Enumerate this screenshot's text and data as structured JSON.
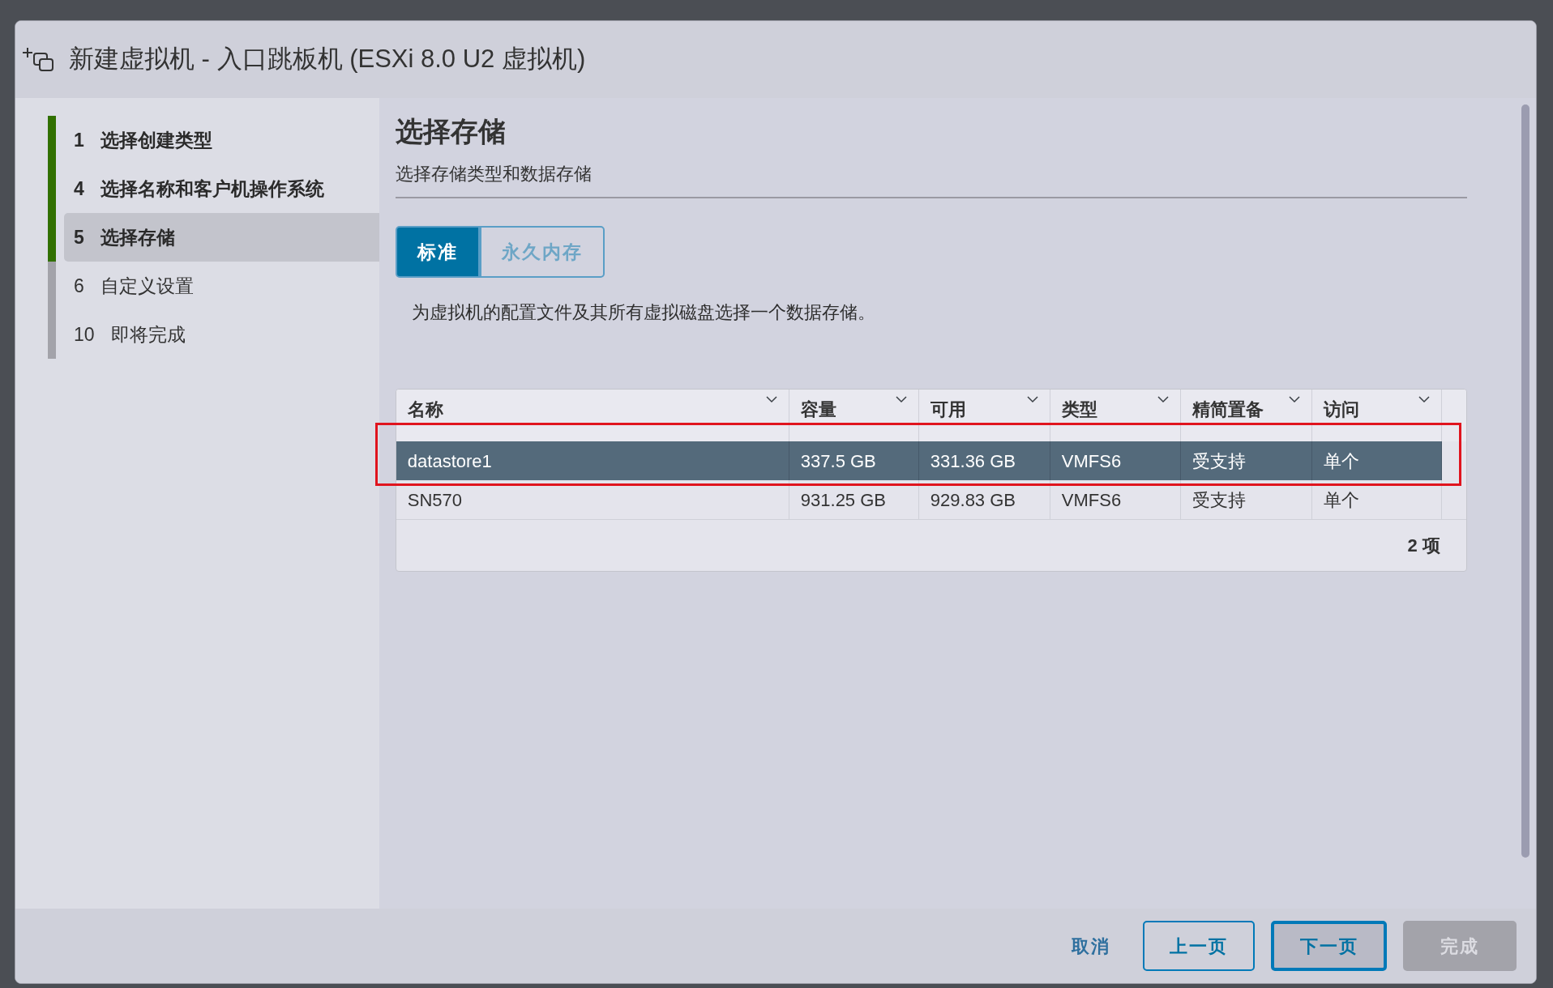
{
  "window": {
    "title": "新建虚拟机 - 入口跳板机 (ESXi 8.0 U2 虚拟机)"
  },
  "steps": [
    {
      "number": "1",
      "label": "选择创建类型",
      "reached": true,
      "selected": false
    },
    {
      "number": "4",
      "label": "选择名称和客户机操作系统",
      "reached": true,
      "selected": false
    },
    {
      "number": "5",
      "label": "选择存储",
      "reached": true,
      "selected": true
    },
    {
      "number": "6",
      "label": "自定义设置",
      "reached": false,
      "selected": false
    },
    {
      "number": "10",
      "label": "即将完成",
      "reached": false,
      "selected": false
    }
  ],
  "page": {
    "title": "选择存储",
    "subtitle": "选择存储类型和数据存储"
  },
  "tabs": [
    {
      "label": "标准",
      "selected": true
    },
    {
      "label": "永久内存",
      "selected": false
    }
  ],
  "description": "为虚拟机的配置文件及其所有虚拟磁盘选择一个数据存储。",
  "table": {
    "columns": [
      "名称",
      "容量",
      "可用",
      "类型",
      "精简置备",
      "访问"
    ],
    "rows": [
      {
        "cells": [
          "datastore1",
          "337.5 GB",
          "331.36 GB",
          "VMFS6",
          "受支持",
          "单个"
        ],
        "selected": true
      },
      {
        "cells": [
          "SN570",
          "931.25 GB",
          "929.83 GB",
          "VMFS6",
          "受支持",
          "单个"
        ],
        "selected": false
      }
    ],
    "footer": "2 项"
  },
  "buttons": [
    {
      "label": "取消",
      "kind": "link",
      "disabled": false
    },
    {
      "label": "上一页",
      "kind": "outline",
      "disabled": false
    },
    {
      "label": "下一页",
      "kind": "focused",
      "disabled": false
    },
    {
      "label": "完成",
      "kind": "solid",
      "disabled": true
    }
  ]
}
